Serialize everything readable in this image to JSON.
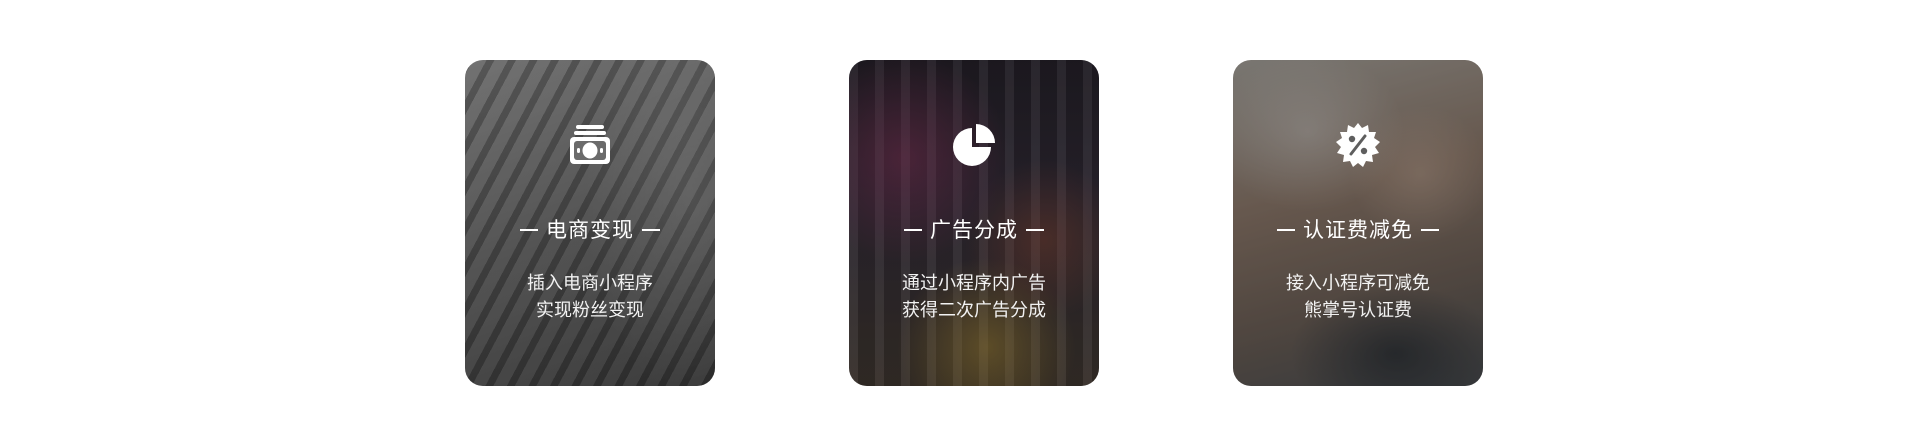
{
  "cards": [
    {
      "icon": "money-icon",
      "title": "电商变现",
      "desc_line1": "插入电商小程序",
      "desc_line2": "实现粉丝变现"
    },
    {
      "icon": "pie-chart-icon",
      "title": "广告分成",
      "desc_line1": "通过小程序内广告",
      "desc_line2": "获得二次广告分成"
    },
    {
      "icon": "discount-badge-icon",
      "title": "认证费减免",
      "desc_line1": "接入小程序可减免",
      "desc_line2": "熊掌号认证费"
    }
  ],
  "colors": {
    "text": "#ffffff",
    "page_background": "#ffffff"
  }
}
